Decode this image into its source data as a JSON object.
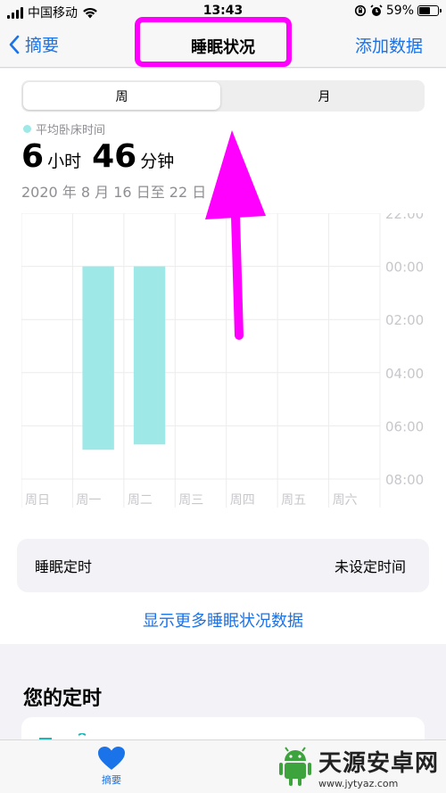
{
  "status_bar": {
    "carrier": "中国移动",
    "time": "13:43",
    "battery_percent": "59%",
    "battery_level": 0.59
  },
  "nav": {
    "back_label": "摘要",
    "title": "睡眠状况",
    "action_label": "添加数据"
  },
  "segmented": {
    "week_label": "周",
    "month_label": "月"
  },
  "summary": {
    "legend_label": "平均卧床时间",
    "hours": "6",
    "hours_unit": "小时",
    "minutes": "46",
    "minutes_unit": "分钟",
    "date_range": "2020 年 8 月 16 日至 22 日"
  },
  "chart_data": {
    "type": "bar",
    "categories": [
      "周日",
      "周一",
      "周二",
      "周三",
      "周四",
      "周五",
      "周六"
    ],
    "y_ticks": [
      "22:00",
      "00:00",
      "02:00",
      "04:00",
      "06:00",
      "08:00"
    ],
    "y_range_hours": [
      22,
      32
    ],
    "series": [
      {
        "ranges": [
          null,
          [
            24.0,
            30.9
          ],
          null,
          null,
          null,
          null,
          null
        ]
      },
      {
        "ranges": [
          null,
          null,
          [
            24.0,
            30.7
          ],
          null,
          null,
          null,
          null
        ]
      }
    ],
    "bar_color": "#9ee8e8",
    "grid": true
  },
  "sleep_schedule": {
    "label": "睡眠定时",
    "value": "未设定时间"
  },
  "more_link": "显示更多睡眠状况数据",
  "section": {
    "title": "您的定时"
  },
  "tab_bar": {
    "summary_label": "摘要"
  },
  "watermark": {
    "main": "天源安卓网",
    "sub": "www.jytyaz.com"
  },
  "colors": {
    "accent": "#1a73e8",
    "annotation": "#ff00ff",
    "bar": "#9ee8e8"
  }
}
